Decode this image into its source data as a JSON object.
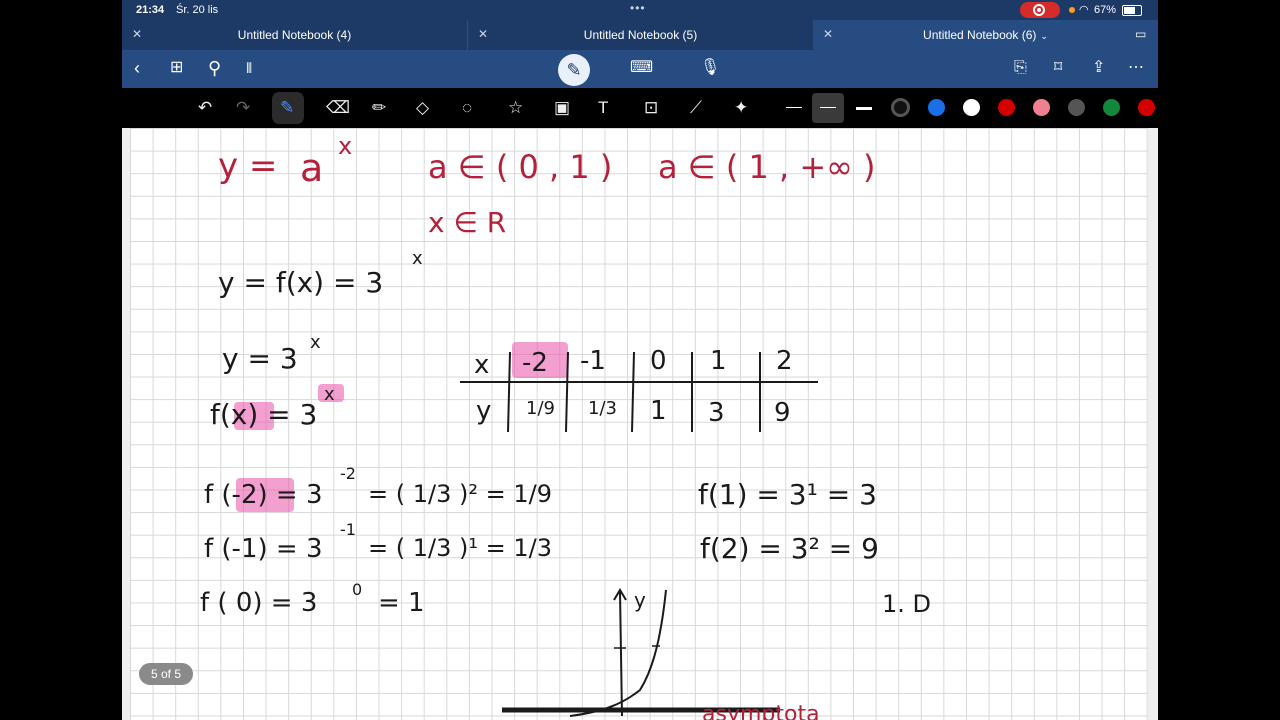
{
  "status": {
    "time": "21:34",
    "date": "Śr. 20 lis",
    "battery": "67%"
  },
  "tabs": [
    {
      "name": "Untitled Notebook (4)"
    },
    {
      "name": "Untitled Notebook (5)"
    },
    {
      "name": "Untitled Notebook (6)"
    }
  ],
  "colors": {
    "accent": "#264c82",
    "ink_red": "#b3213b",
    "highlight": "#e950aa",
    "swatches": [
      "#1a6fe8",
      "#ffffff",
      "#d40000",
      "#f08090",
      "#555555",
      "#11883a",
      "#d40000"
    ]
  },
  "icons": {
    "back": "chevron-left-icon",
    "grid": "grid-icon",
    "search": "search-icon",
    "audio": "audio-icon",
    "pen_mode": "pen-icon",
    "keyboard": "keyboard-icon",
    "mic": "mic-icon",
    "export": "export-icon",
    "bookmark": "bookmark-icon",
    "share": "share-icon",
    "more": "more-icon"
  },
  "notes": {
    "l1_y": "y =",
    "l1_a": "a",
    "l1_x": "x",
    "l1_cond1": "a ∈ ( 0 , 1 )",
    "l1_cond2": "a ∈ ( 1 , +∞ )",
    "l2": "x ∈ R",
    "l3": "y = f(x) = 3",
    "l3_sup": "x",
    "l4": "y = 3",
    "l4_sup": "x",
    "l5": "f(x) = 3",
    "l5_sup": "x",
    "table_x": [
      "x",
      "-2",
      "-1",
      "0",
      "1",
      "2"
    ],
    "table_y": [
      "y",
      "1/9",
      "1/3",
      "1",
      "3",
      "9"
    ],
    "c1": "f (-2) = 3",
    "c1_sup": "-2",
    "c1_rhs": "= ( 1/3 )² = 1/9",
    "c2": "f (-1) = 3",
    "c2_sup": "-1",
    "c2_rhs": "= ( 1/3 )¹ = 1/3",
    "c3": "f ( 0) = 3",
    "c3_sup": "0",
    "c3_rhs": "= 1",
    "r1": "f(1) = 3¹ = 3",
    "r2": "f(2) = 3² = 9",
    "r3": "1. D",
    "axis_y": "y",
    "asym": "asymptota"
  },
  "page_badge": "5 of 5"
}
